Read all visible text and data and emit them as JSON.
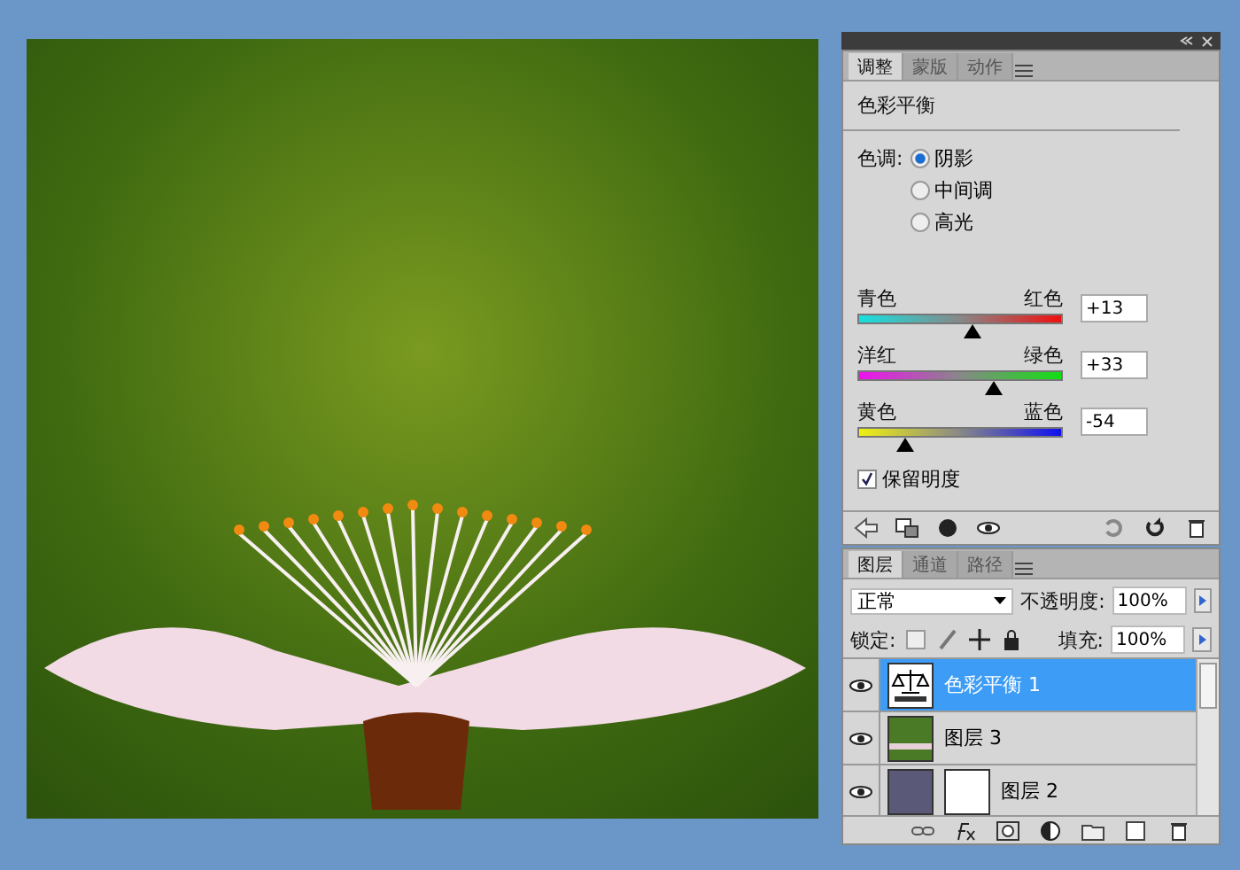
{
  "adjustments_panel": {
    "tabs": [
      {
        "label": "调整",
        "selected": true
      },
      {
        "label": "蒙版",
        "selected": false
      },
      {
        "label": "动作",
        "selected": false
      }
    ],
    "title": "色彩平衡",
    "tone_label": "色调:",
    "tones": [
      {
        "label": "阴影",
        "selected": true
      },
      {
        "label": "中间调",
        "selected": false
      },
      {
        "label": "高光",
        "selected": false
      }
    ],
    "sliders": [
      {
        "kind": "cyan-red",
        "left": "青色",
        "right": "红色",
        "level": 0.565,
        "value": "+13"
      },
      {
        "kind": "magenta-green",
        "left": "洋红",
        "right": "绿色",
        "level": 0.665,
        "value": "+33"
      },
      {
        "kind": "yellow-blue",
        "left": "黄色",
        "right": "蓝色",
        "level": 0.23,
        "value": "-54"
      }
    ],
    "preserve_luminosity": {
      "label": "保留明度",
      "checked": true
    }
  },
  "layers_panel": {
    "tabs": [
      {
        "label": "图层",
        "selected": true
      },
      {
        "label": "通道",
        "selected": false
      },
      {
        "label": "路径",
        "selected": false
      }
    ],
    "blend_mode": "正常",
    "opacity_label": "不透明度:",
    "opacity": "100%",
    "lock_label": "锁定:",
    "fill_label": "填充:",
    "fill": "100%",
    "layers": [
      {
        "kind": "adjustment",
        "name": "色彩平衡 1",
        "selected": true
      },
      {
        "kind": "image",
        "name": "图层 3",
        "selected": false
      },
      {
        "kind": "masked",
        "name": "图层 2",
        "selected": false
      }
    ]
  }
}
